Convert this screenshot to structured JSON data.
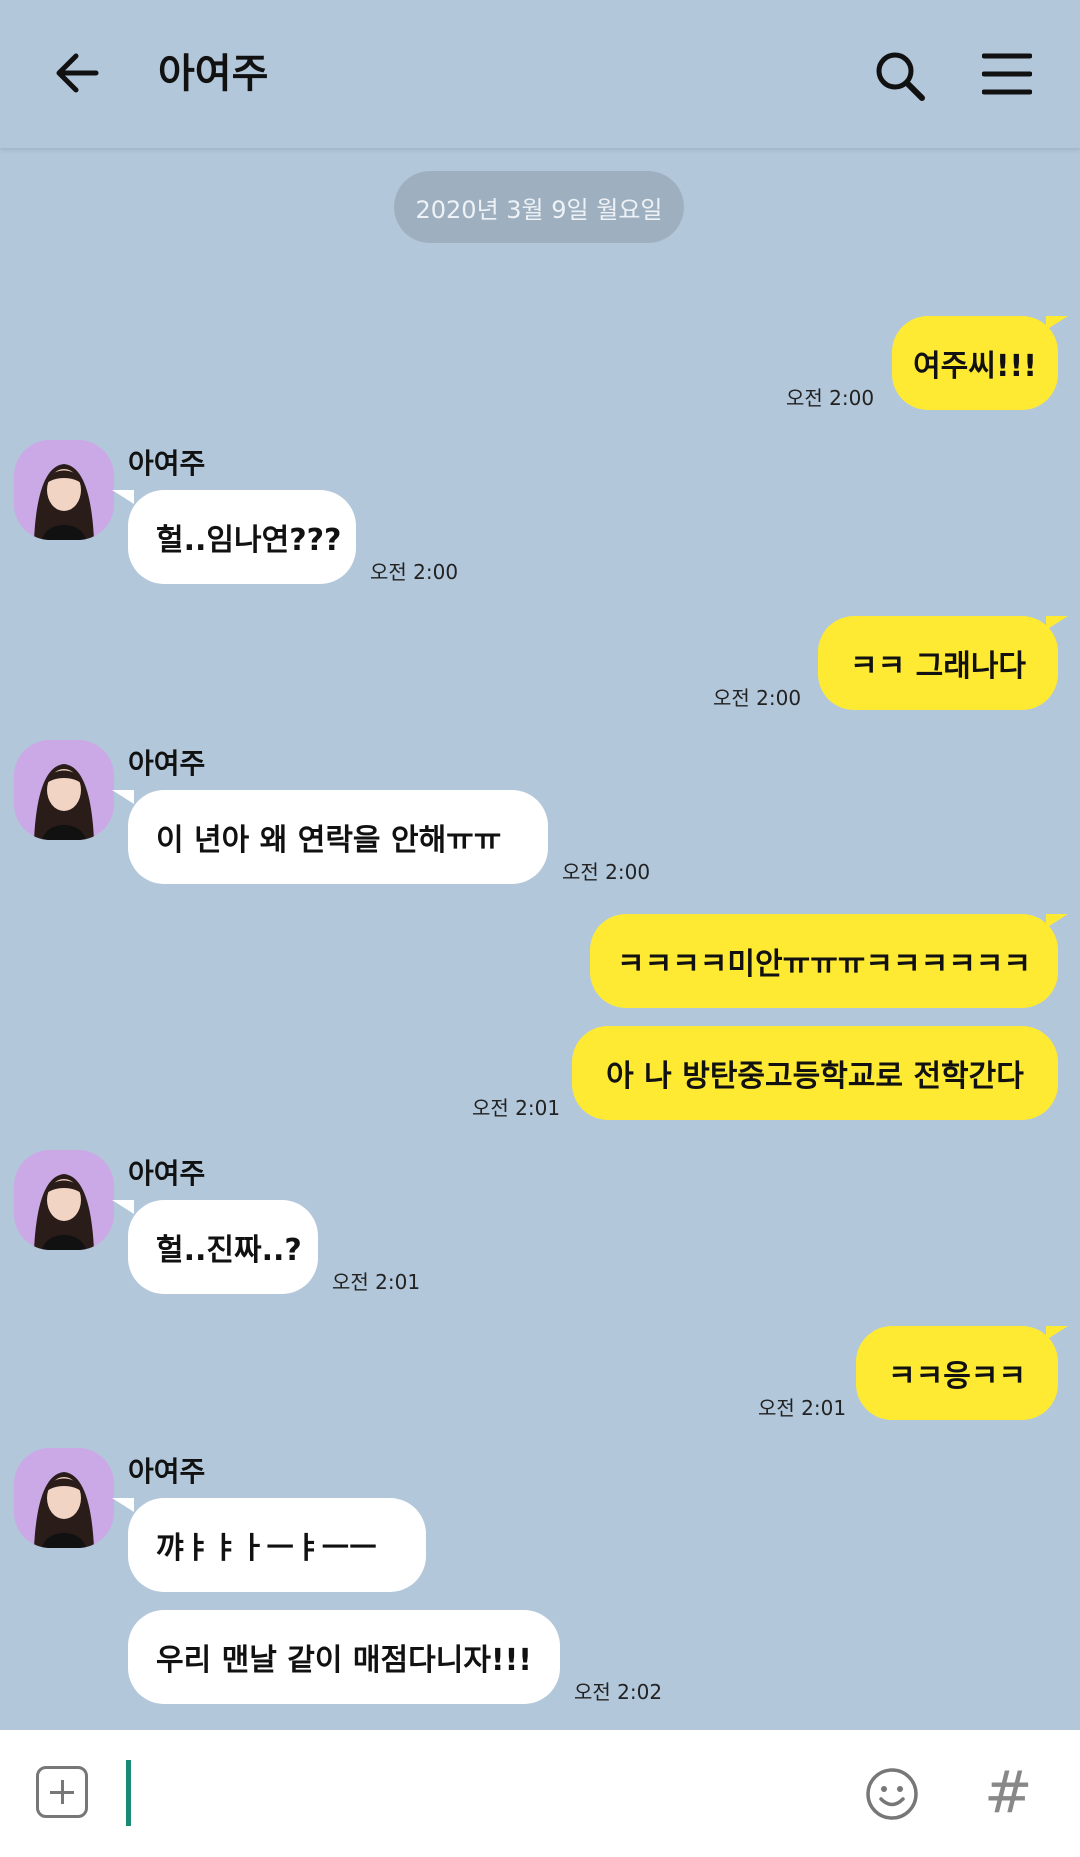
{
  "header": {
    "title": "아여주"
  },
  "date_divider": "2020년 3월 9일 월요일",
  "contact_name": "아여주",
  "messages": [
    {
      "side": "me",
      "text": "여주씨!!!",
      "time": "오전 2:00"
    },
    {
      "side": "other",
      "text": "헐..임나연???",
      "time": "오전 2:00"
    },
    {
      "side": "me",
      "text": "ㅋㅋ 그래나다",
      "time": "오전 2:00"
    },
    {
      "side": "other",
      "text": "이 년아 왜 연락을 안해ㅠㅠ",
      "time": "오전 2:00"
    },
    {
      "side": "me",
      "text": "ㅋㅋㅋㅋ미안ㅠㅠㅠㅋㅋㅋㅋㅋㅋ",
      "time": ""
    },
    {
      "side": "me",
      "text": "아 나 방탄중고등학교로 전학간다",
      "time": "오전 2:01"
    },
    {
      "side": "other",
      "text": "헐..진짜..?",
      "time": "오전 2:01"
    },
    {
      "side": "me",
      "text": "ㅋㅋ응ㅋㅋ",
      "time": "오전 2:01"
    },
    {
      "side": "other",
      "text": "꺄ㅑㅑㅏㅡㅑㅡㅡ",
      "time": ""
    },
    {
      "side": "other",
      "text": "우리 맨날 같이 매점다니자!!!",
      "time": "오전 2:02"
    }
  ],
  "icons": {
    "back": "arrow-left-icon",
    "search": "search-icon",
    "menu": "hamburger-menu-icon",
    "plus": "plus-square-icon",
    "emoji": "smiley-icon",
    "hash": "hash-icon"
  },
  "input": {
    "value": "",
    "hash_symbol": "#"
  },
  "colors": {
    "background": "#b2c7da",
    "my_bubble": "#ffea33",
    "other_bubble": "#ffffff",
    "caret": "#1a8a74"
  }
}
